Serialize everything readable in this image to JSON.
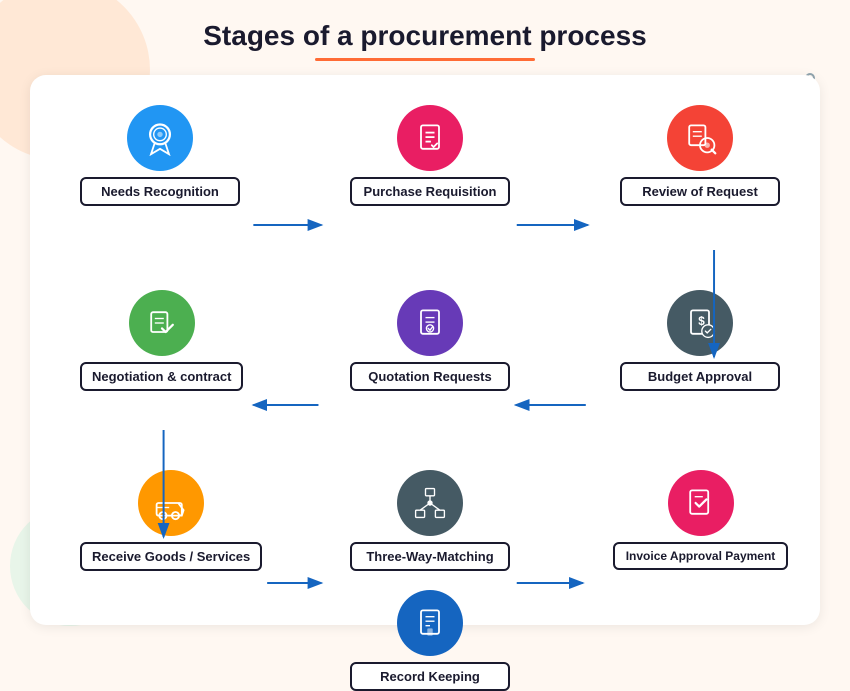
{
  "page": {
    "title": "Stages of a procurement process",
    "background_color": "#fff8f2"
  },
  "diagram": {
    "nodes": [
      {
        "id": "needs-recognition",
        "label": "Needs Recognition",
        "icon_color": "#2196f3",
        "row": 0,
        "col": 0
      },
      {
        "id": "purchase-requisition",
        "label": "Purchase Requisition",
        "icon_color": "#e91e63",
        "row": 0,
        "col": 1
      },
      {
        "id": "review-of-request",
        "label": "Review of Request",
        "icon_color": "#f44336",
        "row": 0,
        "col": 2
      },
      {
        "id": "negotiation-contract",
        "label": "Negotiation & contract",
        "icon_color": "#4caf50",
        "row": 1,
        "col": 0
      },
      {
        "id": "quotation-requests",
        "label": "Quotation Requests",
        "icon_color": "#673ab7",
        "row": 1,
        "col": 1
      },
      {
        "id": "budget-approval",
        "label": "Budget Approval",
        "icon_color": "#455a64",
        "row": 1,
        "col": 2
      },
      {
        "id": "receive-goods",
        "label": "Receive Goods / Services",
        "icon_color": "#ff9800",
        "row": 2,
        "col": 0
      },
      {
        "id": "three-way-matching",
        "label": "Three-Way-Matching",
        "icon_color": "#455a64",
        "row": 2,
        "col": 1
      },
      {
        "id": "invoice-approval",
        "label": "Invoice Approval Payment",
        "icon_color": "#e91e63",
        "row": 2,
        "col": 2
      },
      {
        "id": "record-keeping",
        "label": "Record Keeping",
        "icon_color": "#1565c0",
        "row": 3,
        "col": 1
      }
    ],
    "arrow_color": "#1565c0"
  }
}
